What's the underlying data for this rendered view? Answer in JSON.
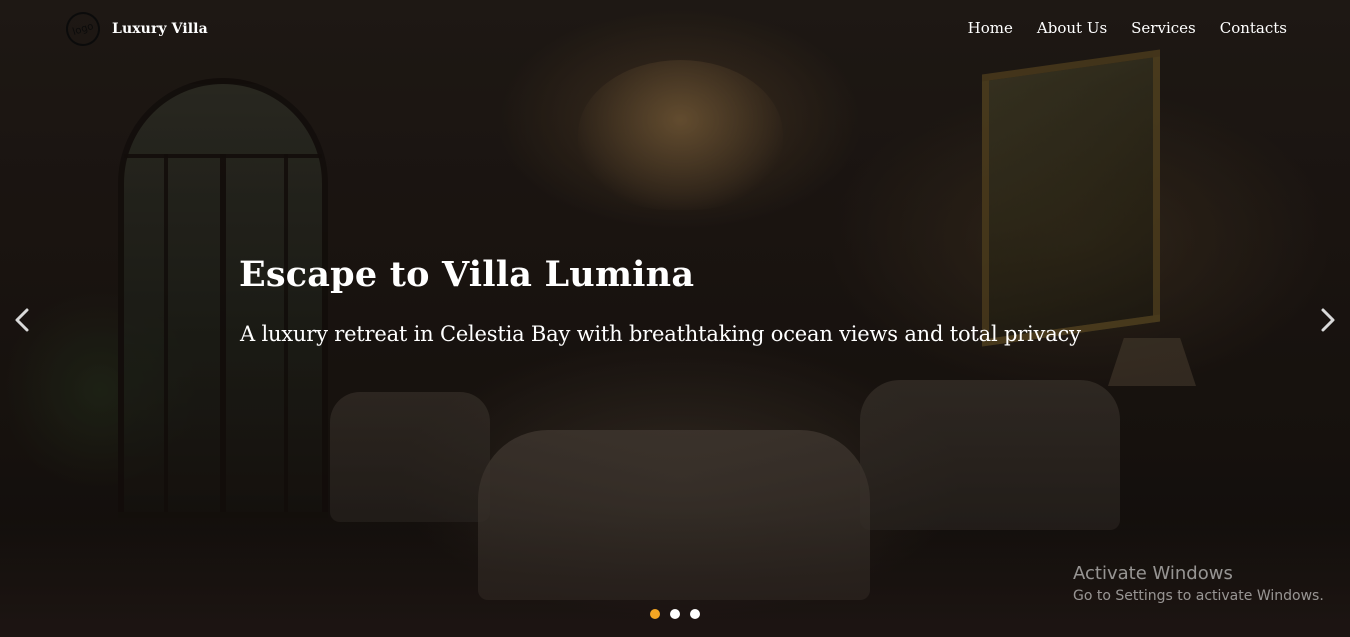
{
  "navbar": {
    "logo_text": "logo",
    "brand_name": "Luxury Villa",
    "links": [
      "Home",
      "About Us",
      "Services",
      "Contacts"
    ]
  },
  "hero": {
    "title": "Escape to Villa Lumina",
    "subtitle": "A luxury retreat in Celestia Bay with breathtaking ocean views and total privacy"
  },
  "carousel": {
    "prev_icon": "chevron-left-icon",
    "next_icon": "chevron-right-icon",
    "slide_count": 3,
    "active_slide": 1,
    "active_color": "#f5a623",
    "inactive_color": "#ffffff"
  },
  "watermark": {
    "title": "Activate Windows",
    "subtitle": "Go to Settings to activate Windows."
  }
}
